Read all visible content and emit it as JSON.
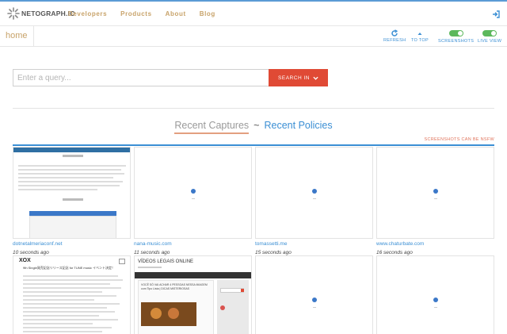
{
  "brand": {
    "name": "NETOGRAPH.IO"
  },
  "nav": {
    "items": [
      "Developers",
      "Products",
      "About",
      "Blog"
    ]
  },
  "subbar": {
    "home": "home",
    "tools": [
      {
        "label": "REFRESH",
        "icon": "refresh-icon"
      },
      {
        "label": "TO TOP",
        "icon": "arrow-up-icon"
      },
      {
        "label": "SCREENSHOTS",
        "icon": "toggle-on-icon"
      },
      {
        "label": "LIVE VIEW",
        "icon": "toggle-on-icon"
      }
    ]
  },
  "search": {
    "placeholder": "Enter a query...",
    "button_label": "SEARCH IN"
  },
  "tabs": {
    "recent_captures": "Recent Captures",
    "separator": "~",
    "recent_policies": "Recent Policies"
  },
  "warning": "SCREENSHOTS CAN BE NSFW",
  "captures": [
    {
      "site": "dotnetalmeriaconf.net",
      "time": "10 seconds ago"
    },
    {
      "site": "nana-music.com",
      "time": "11 seconds ago"
    },
    {
      "site": "tomassetti.me",
      "time": "15 seconds ago"
    },
    {
      "site": "www.chaturbate.com",
      "time": "16 seconds ago"
    }
  ],
  "second_row": {
    "c1": {
      "logo": "XOX",
      "headline": "9th Single発売記念リリース記念 for TUNE music イベント決定！"
    },
    "c2": {
      "title": "VÍDEOS LEGAIS ONLINE",
      "post_title": "VOCÊ SÓ VAI ACHAR 4 PESSOAS NESSA IMAGEM com Tipo Lista | DICAS MISTERIOSAS"
    }
  },
  "colors": {
    "accent_blue": "#3b8fd4",
    "search_red": "#e04a35",
    "nav_gold": "#c8a36a",
    "toggle_green": "#5cb85c"
  }
}
